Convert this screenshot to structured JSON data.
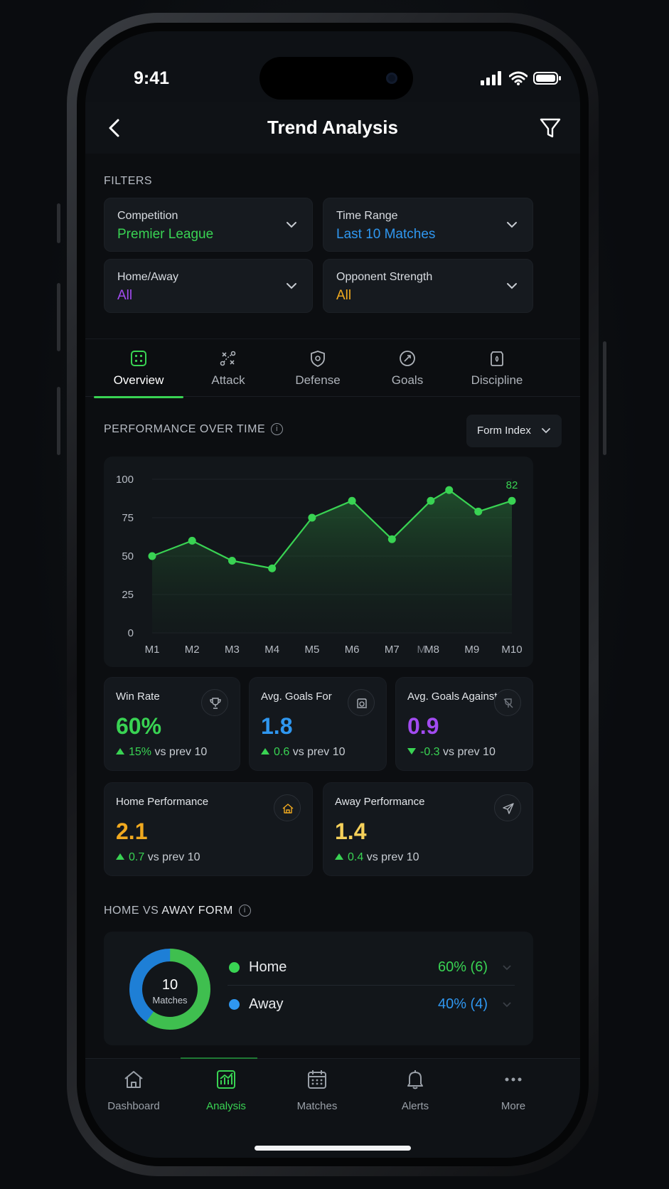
{
  "status_bar": {
    "time": "9:41"
  },
  "header": {
    "title": "Trend Analysis"
  },
  "filters": {
    "section_label": "FILTERS",
    "items": [
      {
        "label": "Competition",
        "value": "Premier League",
        "color": "#39d353"
      },
      {
        "label": "Time Range",
        "value": "Last 10 Matches",
        "color": "#2f97f0"
      },
      {
        "label": "Home/Away",
        "value": "All",
        "color": "#a24bf0"
      },
      {
        "label": "Opponent Strength",
        "value": "All",
        "color": "#f0a91f"
      }
    ]
  },
  "tabs": [
    {
      "label": "Overview",
      "icon": "overview-icon",
      "active": true
    },
    {
      "label": "Attack",
      "icon": "attack-icon",
      "active": false
    },
    {
      "label": "Defense",
      "icon": "shield-icon",
      "active": false
    },
    {
      "label": "Goals",
      "icon": "ball-icon",
      "active": false
    },
    {
      "label": "Discipline",
      "icon": "card-icon",
      "active": false
    }
  ],
  "performance": {
    "section_label": "PERFORMANCE OVER TIME",
    "metric_select": "Form Index"
  },
  "chart_data": {
    "type": "area",
    "categories": [
      "M1",
      "M2",
      "M3",
      "M4",
      "M5",
      "M6",
      "M7",
      "M8",
      "M9",
      "M10"
    ],
    "overlap_tick": "M",
    "y_ticks": [
      "100",
      "75",
      "50",
      "25",
      "0"
    ],
    "ylim": [
      0,
      100
    ],
    "points": [
      {
        "x": 1,
        "y": 50
      },
      {
        "x": 2,
        "y": 60
      },
      {
        "x": 3,
        "y": 47
      },
      {
        "x": 4,
        "y": 42
      },
      {
        "x": 5,
        "y": 75
      },
      {
        "x": 6,
        "y": 86
      },
      {
        "x": 7,
        "y": 61
      },
      {
        "x": 7.97,
        "y": 86
      },
      {
        "x": 8.43,
        "y": 93
      },
      {
        "x": 9.16,
        "y": 79
      },
      {
        "x": 10,
        "y": 86
      }
    ],
    "end_label": "82",
    "color": "#39d353",
    "grid": true
  },
  "stats": [
    {
      "title": "Win Rate",
      "value": "60%",
      "color": "#39d353",
      "trend": "up",
      "delta": "15%",
      "suffix": "vs prev 10",
      "icon": "trophy-icon"
    },
    {
      "title": "Avg. Goals For",
      "value": "1.8",
      "color": "#2f97f0",
      "trend": "up",
      "delta": "0.6",
      "suffix": "vs prev 10",
      "icon": "goal-icon"
    },
    {
      "title": "Avg. Goals Against",
      "value": "0.9",
      "color": "#a24bf0",
      "trend": "down",
      "delta": "-0.3",
      "suffix": "vs prev 10",
      "icon": "no-goal-icon"
    },
    {
      "title": "Home Performance",
      "value": "2.1",
      "color": "#f0a91f",
      "trend": "up",
      "delta": "0.7",
      "suffix": "vs prev 10",
      "icon": "home-icon"
    },
    {
      "title": "Away Performance",
      "value": "1.4",
      "color": "#f5d05a",
      "trend": "up",
      "delta": "0.4",
      "suffix": "vs prev 10",
      "icon": "plane-icon"
    }
  ],
  "form": {
    "section_label_prefix": "HOME VS ",
    "section_label_strong": "AWAY FORM",
    "donut_count": "10",
    "donut_label": "Matches",
    "legend": [
      {
        "name": "Home",
        "pct": "60% (6)",
        "share": 0.6,
        "color": "#39d353"
      },
      {
        "name": "Away",
        "pct": "40% (4)",
        "share": 0.4,
        "color": "#2f97f0"
      }
    ]
  },
  "nav": [
    {
      "label": "Dashboard",
      "icon": "home-icon",
      "active": false
    },
    {
      "label": "Analysis",
      "icon": "chart-icon",
      "active": true
    },
    {
      "label": "Matches",
      "icon": "calendar-icon",
      "active": false
    },
    {
      "label": "Alerts",
      "icon": "bell-icon",
      "active": false
    },
    {
      "label": "More",
      "icon": "more-icon",
      "active": false
    }
  ]
}
